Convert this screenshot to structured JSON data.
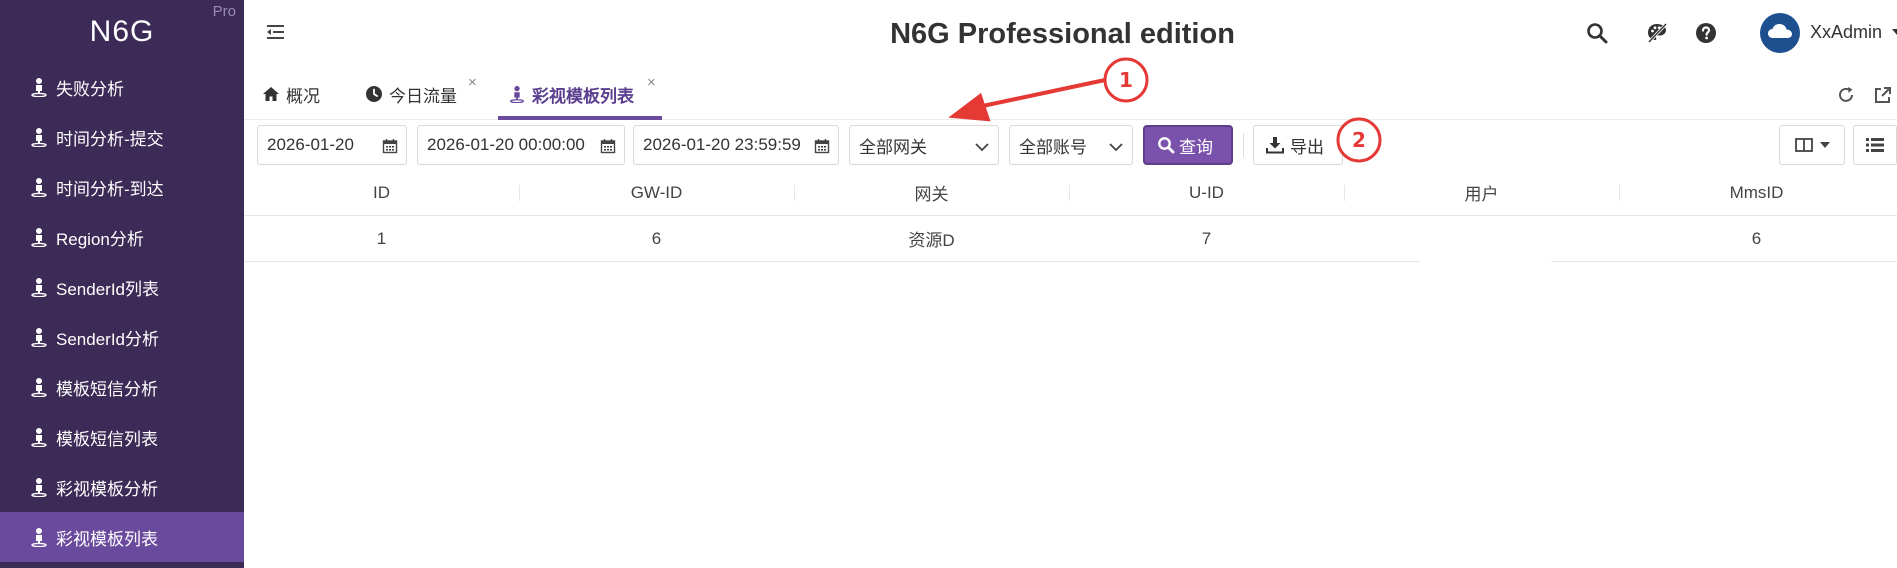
{
  "sidebar": {
    "brand": "N6G",
    "badge": "Pro",
    "items": [
      {
        "label": "失败分析"
      },
      {
        "label": "时间分析-提交"
      },
      {
        "label": "时间分析-到达"
      },
      {
        "label": "Region分析"
      },
      {
        "label": "SenderId列表"
      },
      {
        "label": "SenderId分析"
      },
      {
        "label": "模板短信分析"
      },
      {
        "label": "模板短信列表"
      },
      {
        "label": "彩视模板分析"
      },
      {
        "label": "彩视模板列表",
        "active": true
      }
    ]
  },
  "header": {
    "title": "N6G Professional edition",
    "user": "XxAdmin"
  },
  "tabs": [
    {
      "label": "概况",
      "icon": "home-icon"
    },
    {
      "label": "今日流量",
      "icon": "clock-icon",
      "close": "×"
    },
    {
      "label": "彩视模板列表",
      "icon": "person-pin-icon",
      "close": "×",
      "active": true
    }
  ],
  "toolbar": {
    "date": "2026-01-20",
    "start_time": "2026-01-20 00:00:00",
    "end_time": "2026-01-20 23:59:59",
    "gateway_select": "全部网关",
    "account_select": "全部账号",
    "query_label": "查询",
    "export_label": "导出"
  },
  "table": {
    "columns": [
      "ID",
      "GW-ID",
      "网关",
      "U-ID",
      "用户",
      "MmsID"
    ],
    "rows": [
      {
        "id": "1",
        "gw_id": "6",
        "gateway": "资源D",
        "u_id": "7",
        "user": "",
        "mms_id": "6"
      }
    ]
  },
  "annotations": {
    "marker_1": "1",
    "marker_2": "2"
  },
  "colors": {
    "sidebar_bg": "#3c2a57",
    "sidebar_active": "#6a4a9c",
    "accent": "#7b52ab",
    "annotation_red": "#e53935"
  }
}
